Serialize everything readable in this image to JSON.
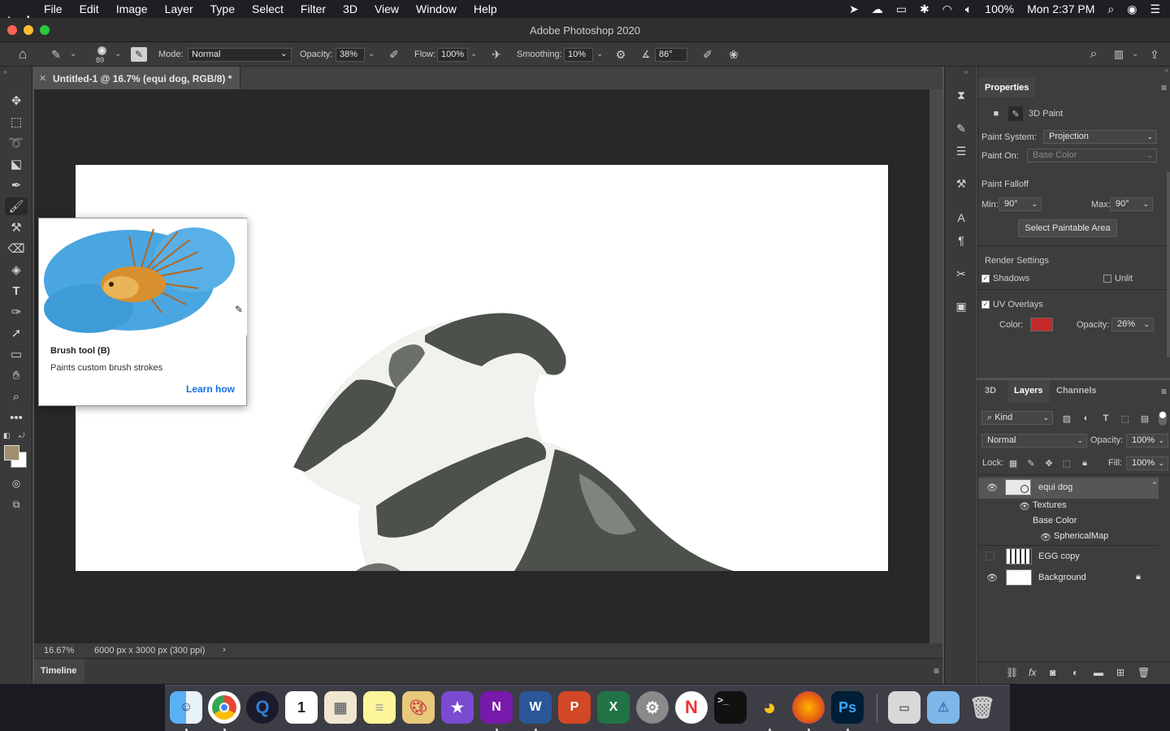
{
  "menubar": {
    "app_name": "Photoshop",
    "items": [
      "File",
      "Edit",
      "Image",
      "Layer",
      "Type",
      "Select",
      "Filter",
      "3D",
      "View",
      "Window",
      "Help"
    ],
    "battery": "100%",
    "clock": "Mon 2:37 PM"
  },
  "window": {
    "title": "Adobe Photoshop 2020"
  },
  "options": {
    "brush_size": "89",
    "mode_label": "Mode:",
    "mode_value": "Normal",
    "opacity_label": "Opacity:",
    "opacity_value": "38%",
    "flow_label": "Flow:",
    "flow_value": "100%",
    "smoothing_label": "Smoothing:",
    "smoothing_value": "10%",
    "angle_value": "86°"
  },
  "document": {
    "tab_title": "Untitled-1 @ 16.7% (equi dog, RGB/8) *"
  },
  "status": {
    "zoom": "16.67%",
    "doc_info": "6000 px x 3000 px (300 ppi)"
  },
  "timeline": {
    "label": "Timeline"
  },
  "tooltip": {
    "title": "Brush tool (B)",
    "description": "Paints custom brush strokes",
    "link": "Learn how"
  },
  "properties": {
    "header": "Properties",
    "mode_label": "3D Paint",
    "paint_system_label": "Paint System:",
    "paint_system_value": "Projection",
    "paint_on_label": "Paint On:",
    "paint_on_value": "Base Color",
    "falloff_label": "Paint Falloff",
    "min_label": "Min:",
    "min_value": "90°",
    "max_label": "Max:",
    "max_value": "90°",
    "select_area_button": "Select Paintable Area",
    "render_label": "Render Settings",
    "shadows_label": "Shadows",
    "unlit_label": "Unlit",
    "uv_label": "UV Overlays",
    "color_label": "Color:",
    "uv_color": "#c42a2a",
    "uv_opacity_label": "Opacity:",
    "uv_opacity_value": "26%"
  },
  "layers_panel": {
    "tabs": [
      "3D",
      "Layers",
      "Channels"
    ],
    "kind_label": "Kind",
    "blend_mode": "Normal",
    "opacity_label": "Opacity:",
    "opacity_value": "100%",
    "lock_label": "Lock:",
    "fill_label": "Fill:",
    "fill_value": "100%",
    "layers": [
      {
        "name": "equi dog",
        "sub": [
          "Textures",
          "Base Color",
          "SphericalMap"
        ]
      },
      {
        "name": "EGG copy"
      },
      {
        "name": "Background"
      }
    ]
  },
  "colors": {
    "foreground": "#a08e6c",
    "background": "#ffffff",
    "accent": "#1473e6"
  }
}
